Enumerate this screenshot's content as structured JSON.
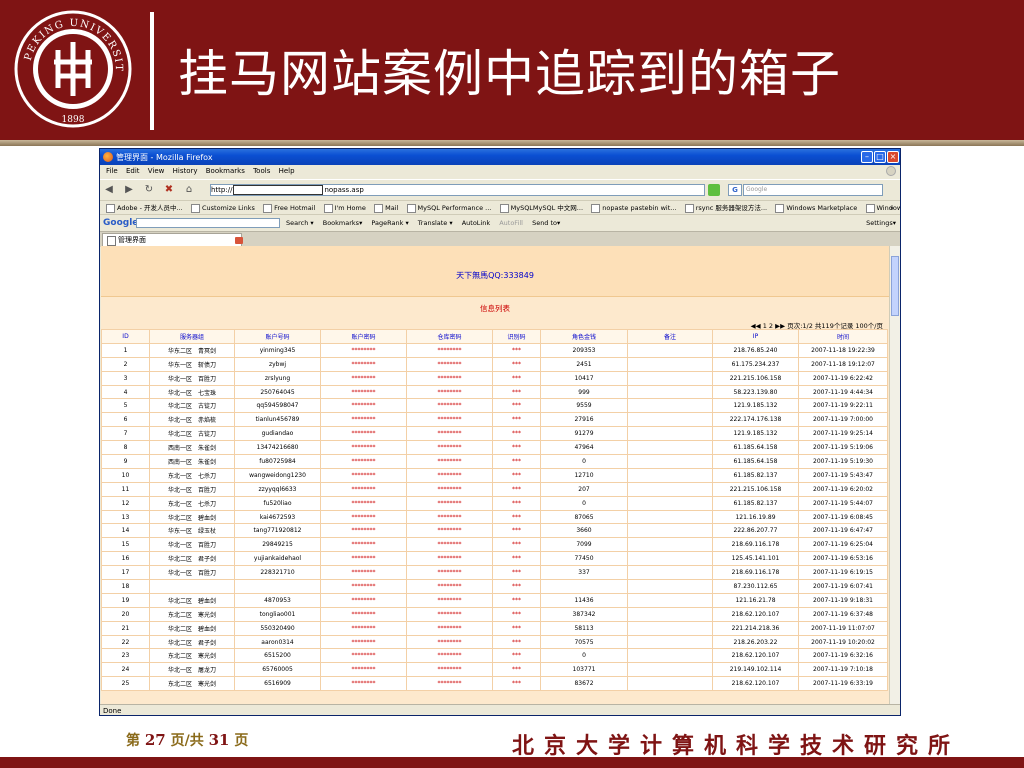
{
  "slide": {
    "title": "挂马网站案例中追踪到的箱子",
    "page_prefix": "第",
    "page_current": "27",
    "page_mid": "页/共",
    "page_total": "31",
    "page_suffix": "页",
    "institute": "北京大学计算机科学技术研究所",
    "logo_text": "PEKING UNIVERSITY",
    "logo_year": "1898",
    "colors": {
      "header_bg": "#7f1414",
      "footer_text": "#7f1414"
    }
  },
  "browser": {
    "window_title": "管理界面 - Mozilla Firefox",
    "menu": [
      "File",
      "Edit",
      "View",
      "History",
      "Bookmarks",
      "Tools",
      "Help"
    ],
    "url_prefix": "http://",
    "url_suffix": "nopass.asp",
    "search_placeholder": "Google",
    "bookmarks": [
      "Adobe - 开发人员中...",
      "Customize Links",
      "Free Hotmail",
      "I'm Home",
      "Mail",
      "MySQL Performance ...",
      "MySQLMySQL 中文网...",
      "nopaste pastebin wit...",
      "rsync 服务器架设方法...",
      "Windows Marketplace",
      "Windows"
    ],
    "bookmarks_more": "»",
    "google_toolbar": {
      "logo": "Google",
      "items": [
        "Search ▾",
        "Bookmarks▾",
        "PageRank ▾",
        "Translate ▾",
        "AutoLink",
        "AutoFill",
        "Send to▾"
      ],
      "settings": "Settings▾"
    },
    "tab_label": "管理界面",
    "status": "Done"
  },
  "page": {
    "banner": "天下無馬QQ:333849",
    "list_title": "信息列表",
    "pager": "◀◀ 1 2 ▶▶ 页次:1/2 共119个记录 100个/页",
    "columns": [
      "ID",
      "服务器组",
      "账户号码",
      "账户密码",
      "仓库密码",
      "识别码",
      "角色金钱",
      "备注",
      "IP",
      "时间"
    ],
    "rows": [
      [
        "1",
        "华东二区　青冥剑",
        "yinming345",
        "********",
        "********",
        "***",
        "209353",
        "",
        "218.76.85.240",
        "2007-11-18 19:22:39"
      ],
      [
        "2",
        "华东一区　斩债刀",
        "zybwj",
        "********",
        "********",
        "***",
        "2451",
        "",
        "61.175.234.237",
        "2007-11-18 19:12:07"
      ],
      [
        "3",
        "华北一区　百胜刀",
        "zrslyung",
        "********",
        "********",
        "***",
        "10417",
        "",
        "221.215.106.158",
        "2007-11-19 6:22:42"
      ],
      [
        "4",
        "华北一区　七宝珠",
        "250764045",
        "********",
        "********",
        "***",
        "999",
        "",
        "58.223.139.80",
        "2007-11-19 4:44:34"
      ],
      [
        "5",
        "华北二区　古锭刀",
        "qq594598047",
        "********",
        "********",
        "***",
        "9559",
        "",
        "121.9.185.132",
        "2007-11-19 9:22:11"
      ],
      [
        "6",
        "华北一区　赤焰梳",
        "tianlun456789",
        "********",
        "********",
        "***",
        "27916",
        "",
        "222.174.176.138",
        "2007-11-19 7:00:00"
      ],
      [
        "7",
        "华北二区　古锭刀",
        "gudiandao",
        "********",
        "********",
        "***",
        "91279",
        "",
        "121.9.185.132",
        "2007-11-19 9:25:14"
      ],
      [
        "8",
        "西南一区　朱雀剑",
        "13474216680",
        "********",
        "********",
        "***",
        "47964",
        "",
        "61.185.64.158",
        "2007-11-19 5:19:06"
      ],
      [
        "9",
        "西南一区　朱雀剑",
        "fu80725984",
        "********",
        "********",
        "***",
        "0",
        "",
        "61.185.64.158",
        "2007-11-19 5:19:30"
      ],
      [
        "10",
        "东北一区　七杀刀",
        "wangweidong1230",
        "********",
        "********",
        "***",
        "12710",
        "",
        "61.185.82.137",
        "2007-11-19 5:43:47"
      ],
      [
        "11",
        "华北一区　百胜刀",
        "zzyyqql6633",
        "********",
        "********",
        "***",
        "207",
        "",
        "221.215.106.158",
        "2007-11-19 6:20:02"
      ],
      [
        "12",
        "东北一区　七杀刀",
        "fu520liao",
        "********",
        "********",
        "***",
        "0",
        "",
        "61.185.82.137",
        "2007-11-19 5:44:07"
      ],
      [
        "13",
        "华北二区　碧血剑",
        "kai4672593",
        "********",
        "********",
        "***",
        "87065",
        "",
        "121.16.19.89",
        "2007-11-19 6:08:45"
      ],
      [
        "14",
        "华东一区　绿玉杖",
        "tang771920812",
        "********",
        "********",
        "***",
        "3660",
        "",
        "222.86.207.77",
        "2007-11-19 6:47:47"
      ],
      [
        "15",
        "华北一区　百胜刀",
        "29849215",
        "********",
        "********",
        "***",
        "7099",
        "",
        "218.69.116.178",
        "2007-11-19 6:25:04"
      ],
      [
        "16",
        "华北二区　君子剑",
        "yujiankaidehaol",
        "********",
        "********",
        "***",
        "77450",
        "",
        "125.45.141.101",
        "2007-11-19 6:53:16"
      ],
      [
        "17",
        "华北一区　百胜刀",
        "228321710",
        "********",
        "********",
        "***",
        "337",
        "",
        "218.69.116.178",
        "2007-11-19 6:19:15"
      ],
      [
        "18",
        "",
        "",
        "********",
        "********",
        "***",
        "",
        "",
        "87.230.112.65",
        "2007-11-19 6:07:41"
      ],
      [
        "19",
        "华北二区　碧血剑",
        "4870953",
        "********",
        "********",
        "***",
        "11436",
        "",
        "121.16.21.78",
        "2007-11-19 9:18:31"
      ],
      [
        "20",
        "东北二区　寒光剑",
        "tongliao001",
        "********",
        "********",
        "***",
        "387342",
        "",
        "218.62.120.107",
        "2007-11-19 6:37:48"
      ],
      [
        "21",
        "华北二区　碧血剑",
        "550320490",
        "********",
        "********",
        "***",
        "58113",
        "",
        "221.214.218.36",
        "2007-11-19 11:07:07"
      ],
      [
        "22",
        "华北二区　君子剑",
        "aaron0314",
        "********",
        "********",
        "***",
        "70575",
        "",
        "218.26.203.22",
        "2007-11-19 10:20:02"
      ],
      [
        "23",
        "东北二区　寒光剑",
        "6515200",
        "********",
        "********",
        "***",
        "0",
        "",
        "218.62.120.107",
        "2007-11-19 6:32:16"
      ],
      [
        "24",
        "华北一区　屠龙刀",
        "65760005",
        "********",
        "********",
        "***",
        "103771",
        "",
        "219.149.102.114",
        "2007-11-19 7:10:18"
      ],
      [
        "25",
        "东北二区　寒光剑",
        "6516909",
        "********",
        "********",
        "***",
        "83672",
        "",
        "218.62.120.107",
        "2007-11-19 6:33:19"
      ]
    ]
  }
}
